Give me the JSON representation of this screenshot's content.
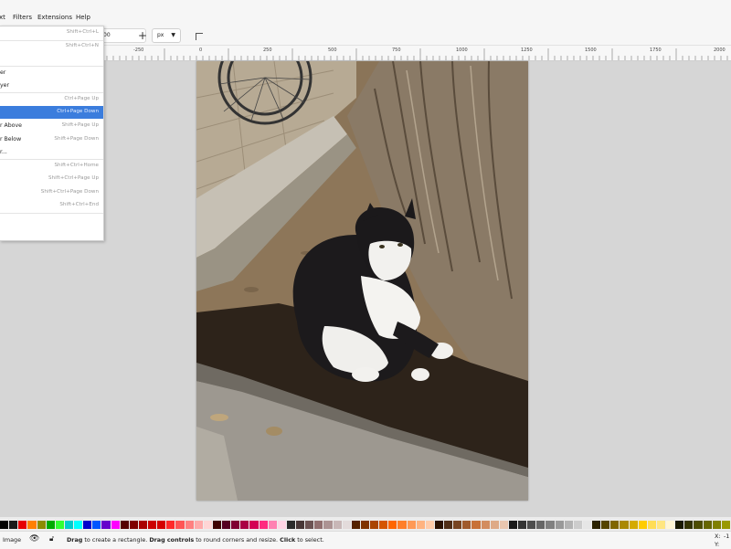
{
  "menubar": {
    "items": [
      "xt",
      "Filters",
      "Extensions",
      "Help"
    ]
  },
  "toolbar": {
    "value": "00",
    "unit": "px",
    "plus": "+"
  },
  "ruler": {
    "ticks": [
      "-250",
      "0",
      "250",
      "500",
      "750",
      "1000",
      "1250",
      "1500",
      "1750",
      "2000"
    ]
  },
  "layer_menu": {
    "items": [
      {
        "label": "",
        "shortcut": "Shift+Ctrl+L"
      },
      {
        "label": "",
        "shortcut": "Shift+Ctrl+N"
      },
      {
        "label": "er",
        "shortcut": ""
      },
      {
        "label": "yer",
        "shortcut": ""
      },
      {
        "label": "",
        "shortcut": "Ctrl+Page Up"
      },
      {
        "label": "",
        "shortcut": "Ctrl+Page Down",
        "highlighted": true
      },
      {
        "label": "r Above",
        "shortcut": "Shift+Page Up"
      },
      {
        "label": "r Below",
        "shortcut": "Shift+Page Down"
      },
      {
        "label": "r...",
        "shortcut": ""
      },
      {
        "label": "",
        "shortcut": "Shift+Ctrl+Home"
      },
      {
        "label": "",
        "shortcut": "Shift+Ctrl+Page Up"
      },
      {
        "label": "",
        "shortcut": "Shift+Ctrl+Page Down"
      },
      {
        "label": "",
        "shortcut": "Shift+Ctrl+End"
      }
    ]
  },
  "canvas": {
    "image": "cat-sitting-by-tree-photo"
  },
  "palette": {
    "colors": [
      "#000000",
      "#1a1a1a",
      "#e60000",
      "#ff8000",
      "#8c8c00",
      "#00aa00",
      "#33ff33",
      "#00cccc",
      "#00ffff",
      "#0000cc",
      "#0055ff",
      "#6600cc",
      "#ff00ff",
      "#550000",
      "#800000",
      "#aa0000",
      "#cc0000",
      "#d40000",
      "#ff2a2a",
      "#ff5555",
      "#ff8080",
      "#ffaaaa",
      "#ffd5d5",
      "#400000",
      "#550022",
      "#800033",
      "#aa0044",
      "#d40055",
      "#ff2a7f",
      "#ff80b2",
      "#ffd5e5",
      "#2b2b2b",
      "#483737",
      "#6c5353",
      "#916f6f",
      "#ac9393",
      "#c8b7b7",
      "#e3dbdb",
      "#552200",
      "#803300",
      "#aa4400",
      "#d45500",
      "#ff6600",
      "#ff7f2a",
      "#ff9955",
      "#ffb380",
      "#ffccaa",
      "#2b1100",
      "#502d16",
      "#784421",
      "#a05a2c",
      "#c87137",
      "#d38d5f",
      "#deaa87",
      "#e9c6af",
      "#1a1a1a",
      "#333333",
      "#4d4d4d",
      "#666666",
      "#808080",
      "#999999",
      "#b3b3b3",
      "#cccccc",
      "#e6e6e6",
      "#2b2200",
      "#554400",
      "#806600",
      "#aa8800",
      "#d4aa00",
      "#ffcc00",
      "#ffdd55",
      "#ffe680",
      "#fff6d5",
      "#1a1a00",
      "#333300",
      "#4d4d00",
      "#666600",
      "#808000",
      "#999900"
    ]
  },
  "status": {
    "layer": "Image",
    "message_parts": [
      "Drag",
      " to create a rectangle. ",
      "Drag controls",
      " to round corners and resize. ",
      "Click",
      " to select."
    ],
    "x_label": "X:",
    "x_value": "-1",
    "y_label": "Y:"
  }
}
